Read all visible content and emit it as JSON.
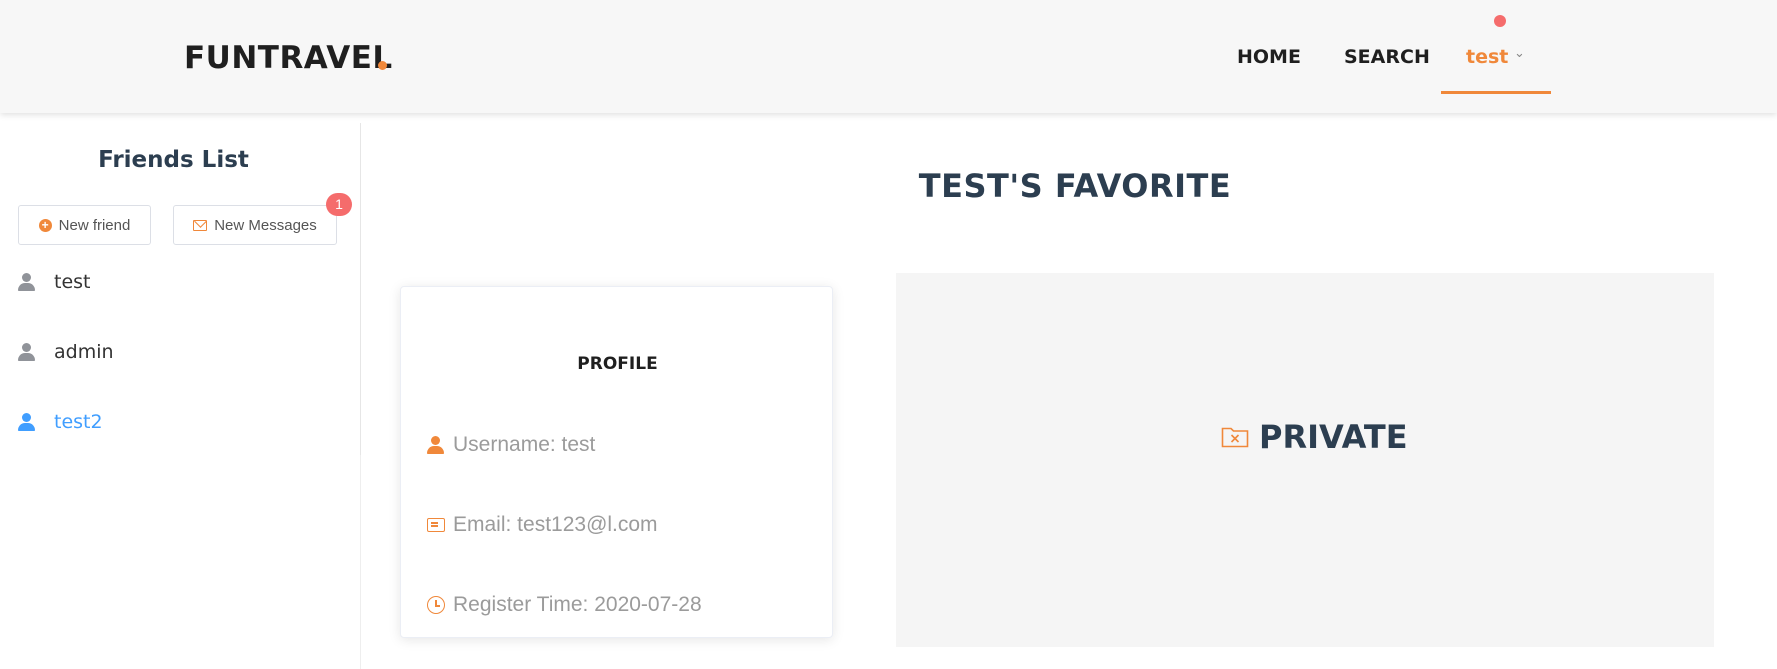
{
  "header": {
    "logo": "FUNTRAVEL",
    "nav": {
      "home": "HOME",
      "search": "SEARCH",
      "user": "test"
    }
  },
  "sidebar": {
    "title": "Friends List",
    "new_friend_label": "New friend",
    "new_messages_label": "New Messages",
    "messages_badge": "1",
    "friends": [
      "test",
      "admin",
      "test2"
    ]
  },
  "main": {
    "title": "TEST'S FAVORITE",
    "profile": {
      "title": "PROFILE",
      "username": "Username: test",
      "email": "Email: test123@l.com",
      "register_time": "Register Time: 2020-07-28"
    },
    "favorites_status": "PRIVATE"
  },
  "colors": {
    "accent": "#f0883a",
    "badge": "#f56c6c",
    "active_link": "#409eff",
    "heading": "#2c3e50"
  },
  "icons": {
    "new_friend": "plus-circle-icon",
    "messages": "mail-icon",
    "friend": "user-icon",
    "username": "user-icon",
    "email": "id-card-icon",
    "register": "clock-icon",
    "private": "folder-delete-icon"
  }
}
